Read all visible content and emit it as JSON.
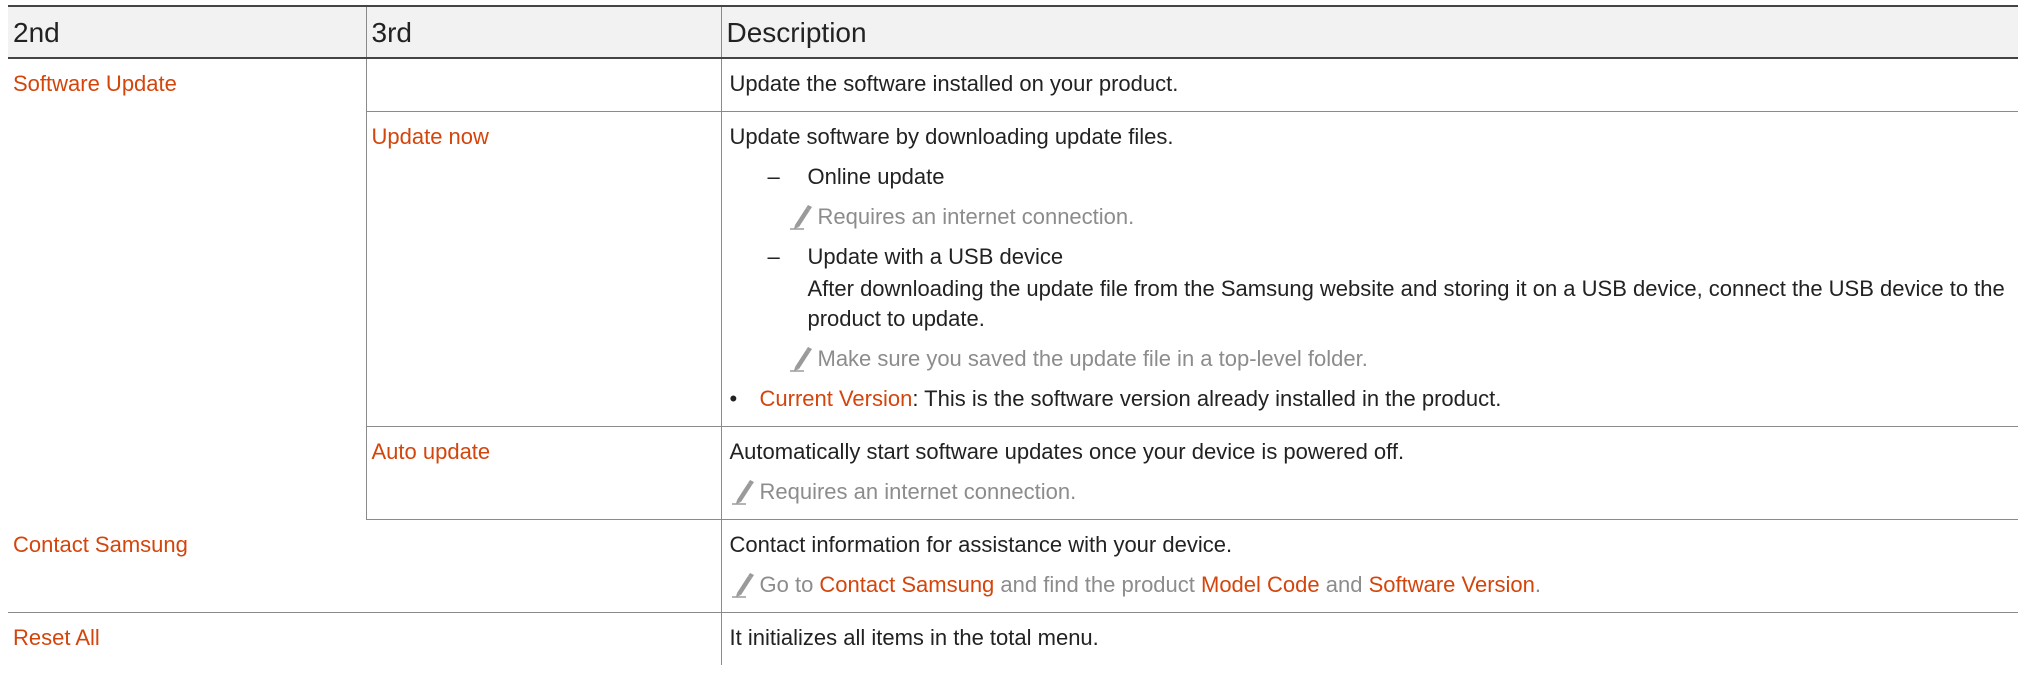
{
  "header": {
    "col1": "2nd",
    "col2": "3rd",
    "col3": "Description"
  },
  "rows": {
    "software_update": {
      "name": "Software Update",
      "desc": "Update the software installed on your product."
    },
    "update_now": {
      "name": "Update now",
      "desc": "Update software by downloading update files.",
      "online_dash": "–",
      "online_title": "Online update",
      "online_note": "Requires an internet connection.",
      "usb_dash": "–",
      "usb_title": "Update with a USB device",
      "usb_text": "After downloading the update file from the Samsung website and storing it on a USB device, connect the USB device to the product to update.",
      "usb_note": "Make sure you saved the update file in a top-level folder.",
      "bullet": "•",
      "current_version_label": "Current Version",
      "current_version_text": ": This is the software version already installed in the product."
    },
    "auto_update": {
      "name": "Auto update",
      "desc": "Automatically start software updates once your device is powered off.",
      "note": "Requires an internet connection."
    },
    "contact_samsung": {
      "name": "Contact Samsung",
      "desc": "Contact information for assistance with your device.",
      "note_prefix": "Go to ",
      "note_link1": "Contact Samsung",
      "note_mid1": " and find the product ",
      "note_link2": "Model Code",
      "note_mid2": " and ",
      "note_link3": "Software Version",
      "note_end": "."
    },
    "reset_all": {
      "name": "Reset All",
      "desc": "It initializes all items in the total menu."
    }
  },
  "icons": {
    "note": "pencil-icon"
  },
  "colors": {
    "accent": "#d4450c",
    "note_text": "#8c8c8c",
    "header_bg": "#f2f2f2"
  }
}
